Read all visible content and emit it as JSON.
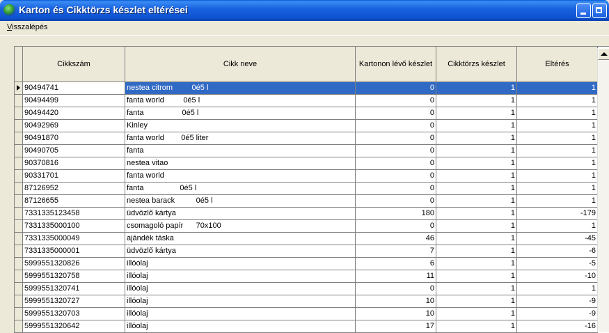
{
  "window": {
    "title": "Karton és Cikktörzs készlet eltérései"
  },
  "menu": {
    "back": "Visszalépés"
  },
  "table": {
    "columns": [
      "Cikkszám",
      "Cikk neve",
      "Kartonon lévő készlet",
      "Cikktörzs készlet",
      "Eltérés"
    ],
    "selected_row": 0,
    "rows": [
      [
        "90494741",
        "nestea citrom         0é5 l",
        "0",
        "1",
        "1"
      ],
      [
        "90494499",
        "fanta world         0é5 l",
        "0",
        "1",
        "1"
      ],
      [
        "90494420",
        "fanta                  0é5 l",
        "0",
        "1",
        "1"
      ],
      [
        "90492969",
        "Kinley",
        "0",
        "1",
        "1"
      ],
      [
        "90491870",
        "fanta world        0é5 liter",
        "0",
        "1",
        "1"
      ],
      [
        "90490705",
        "fanta",
        "0",
        "1",
        "1"
      ],
      [
        "90370816",
        "nestea vitao",
        "0",
        "1",
        "1"
      ],
      [
        "90331701",
        "fanta world",
        "0",
        "1",
        "1"
      ],
      [
        "87126952",
        "fanta                 0é5 l",
        "0",
        "1",
        "1"
      ],
      [
        "87126655",
        "nestea barack          0é5 l",
        "0",
        "1",
        "1"
      ],
      [
        "7331335123458",
        "üdvözlő kártya",
        "180",
        "1",
        "-179"
      ],
      [
        "7331335000100",
        "csomagoló papír      70x100",
        "0",
        "1",
        "1"
      ],
      [
        "7331335000049",
        "ajándék táska",
        "46",
        "1",
        "-45"
      ],
      [
        "7331335000001",
        "üdvözlő kártya",
        "7",
        "1",
        "-6"
      ],
      [
        "5999551320826",
        "illóolaj",
        "6",
        "1",
        "-5"
      ],
      [
        "5999551320758",
        "illóolaj",
        "11",
        "1",
        "-10"
      ],
      [
        "5999551320741",
        "illóolaj",
        "0",
        "1",
        "1"
      ],
      [
        "5999551320727",
        "illóolaj",
        "10",
        "1",
        "-9"
      ],
      [
        "5999551320703",
        "illóolaj",
        "10",
        "1",
        "-9"
      ],
      [
        "5999551320642",
        "illóolaj",
        "17",
        "1",
        "-16"
      ]
    ]
  }
}
